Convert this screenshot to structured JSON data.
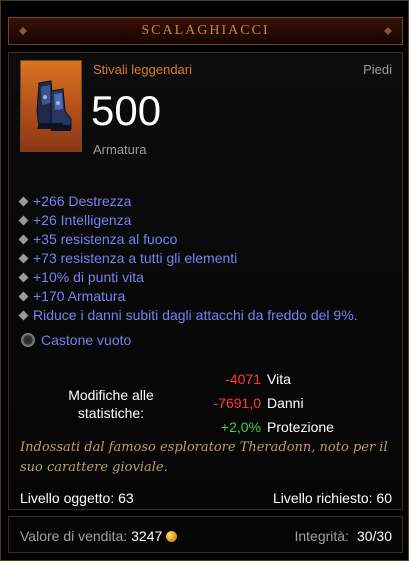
{
  "item": {
    "name": "SCALAGHIACCI",
    "type": "Stivali leggendari",
    "slot": "Piedi",
    "armor_value": "500",
    "armor_label": "Armatura"
  },
  "affixes": [
    "+266 Destrezza",
    "+26 Intelligenza",
    "+35 resistenza al fuoco",
    "+73 resistenza a tutti gli elementi",
    "+10% di punti vita",
    "+170 Armatura",
    "Riduce i danni subiti dagli attacchi da freddo del 9%."
  ],
  "socket": {
    "label": "Castone vuoto"
  },
  "stat_changes": {
    "label": "Modifiche alle statistiche:",
    "rows": [
      {
        "value": "-4071",
        "name": "Vita",
        "trend": "negative"
      },
      {
        "value": "-7691,0",
        "name": "Danni",
        "trend": "negative"
      },
      {
        "value": "+2,0%",
        "name": "Protezione",
        "trend": "positive"
      }
    ]
  },
  "flavor_text": "Indossati dal famoso esploratore Theradonn, noto per il suo carattere gioviale.",
  "item_level": "Livello oggetto: 63",
  "required_level": "Livello richiesto: 60",
  "footer": {
    "sell_label": "Valore di vendita:",
    "sell_value": "3247",
    "durability_label": "Integrità:",
    "durability_value": "30/30"
  },
  "colors": {
    "legendary": "#d97a2e",
    "affix": "#7b7ff3",
    "negative": "#ff3a3a",
    "positive": "#3fd23f",
    "flavor": "#b9a06a"
  },
  "icons": [
    "boots-icon",
    "bullet-icon",
    "socket-icon",
    "gold-coin-icon"
  ]
}
